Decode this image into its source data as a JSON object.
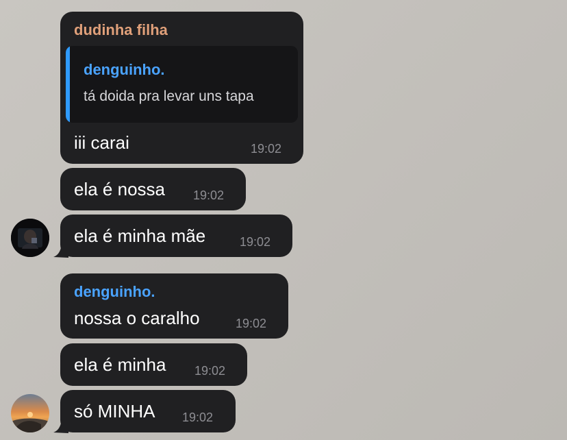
{
  "colors": {
    "background": "#c6c3be",
    "bubble": "#202022",
    "reply_box": "#151517",
    "accent_blue": "#4aa3ff",
    "sender_orange": "#e0a07a",
    "timestamp": "#8e8e93"
  },
  "messages": [
    {
      "sender": "dudinha filha",
      "reply": {
        "name": "denguinho.",
        "text": "tá doida pra levar uns tapa"
      },
      "text": "iii carai",
      "time": "19:02"
    },
    {
      "text": "ela é nossa",
      "time": "19:02"
    },
    {
      "text": "ela é minha mãe",
      "time": "19:02",
      "avatar": "avatar-dark"
    },
    {
      "sender": "denguinho.",
      "text": "nossa o caralho",
      "time": "19:02"
    },
    {
      "text": "ela é minha",
      "time": "19:02"
    },
    {
      "text": "só MINHA",
      "time": "19:02",
      "avatar": "avatar-sunset"
    }
  ]
}
